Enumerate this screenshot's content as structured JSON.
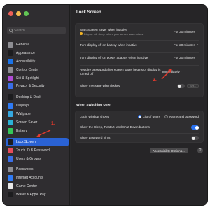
{
  "search": {
    "placeholder": "Search"
  },
  "sidebar": {
    "items": [
      {
        "label": "General",
        "color": "#8e8e93"
      },
      {
        "label": "Appearance",
        "color": "#1c1c1e"
      },
      {
        "label": "Accessibility",
        "color": "#1a73e8"
      },
      {
        "label": "Control Center",
        "color": "#8e8e93"
      },
      {
        "label": "Siri & Spotlight",
        "color": "#b04bd6"
      },
      {
        "label": "Privacy & Security",
        "color": "#3a6ee8"
      },
      {
        "label": "Desktop & Dock",
        "color": "#1c1c1e"
      },
      {
        "label": "Displays",
        "color": "#2f7bf5"
      },
      {
        "label": "Wallpaper",
        "color": "#35a8e0"
      },
      {
        "label": "Screen Saver",
        "color": "#2bb3d6"
      },
      {
        "label": "Battery",
        "color": "#34c759"
      },
      {
        "label": "Lock Screen",
        "color": "#1c1c1e"
      },
      {
        "label": "Touch ID & Password",
        "color": "#e84b5a"
      },
      {
        "label": "Users & Groups",
        "color": "#3a6ee8"
      },
      {
        "label": "Passwords",
        "color": "#8e8e93"
      },
      {
        "label": "Internet Accounts",
        "color": "#2f7bf5"
      },
      {
        "label": "Game Center",
        "color": "#e8e8e8"
      },
      {
        "label": "Wallet & Apple Pay",
        "color": "#1c1c1e"
      }
    ],
    "selected": "Lock Screen"
  },
  "main": {
    "title": "Lock Screen",
    "nav_arrows": "‹ ›",
    "rows": [
      {
        "label": "Start Screen Saver when inactive",
        "value": "For 30 minutes",
        "note": "Display will sleep before your screen saver starts."
      },
      {
        "label": "Turn display off on battery when inactive",
        "value": "For 20 minutes"
      },
      {
        "label": "Turn display off on power adapter when inactive",
        "value": "For 20 minutes"
      },
      {
        "label": "Require password after screen saver begins or display is turned off",
        "value": "Immediately"
      },
      {
        "label": "Show message when locked",
        "button": "Set..."
      }
    ],
    "switching": {
      "heading": "When Switching User",
      "login_label": "Login window shows",
      "opt1": "List of users",
      "opt2": "Name and password",
      "sleep_label": "Show the Sleep, Restart, and Shut Down buttons",
      "hints_label": "Show password hints"
    },
    "accessibility_button": "Accessibility Options...",
    "help": "?"
  },
  "annotations": {
    "one": "1.",
    "two": "2."
  },
  "colors": {
    "accent": "#2a62d4",
    "annotation": "#e83a2c"
  }
}
